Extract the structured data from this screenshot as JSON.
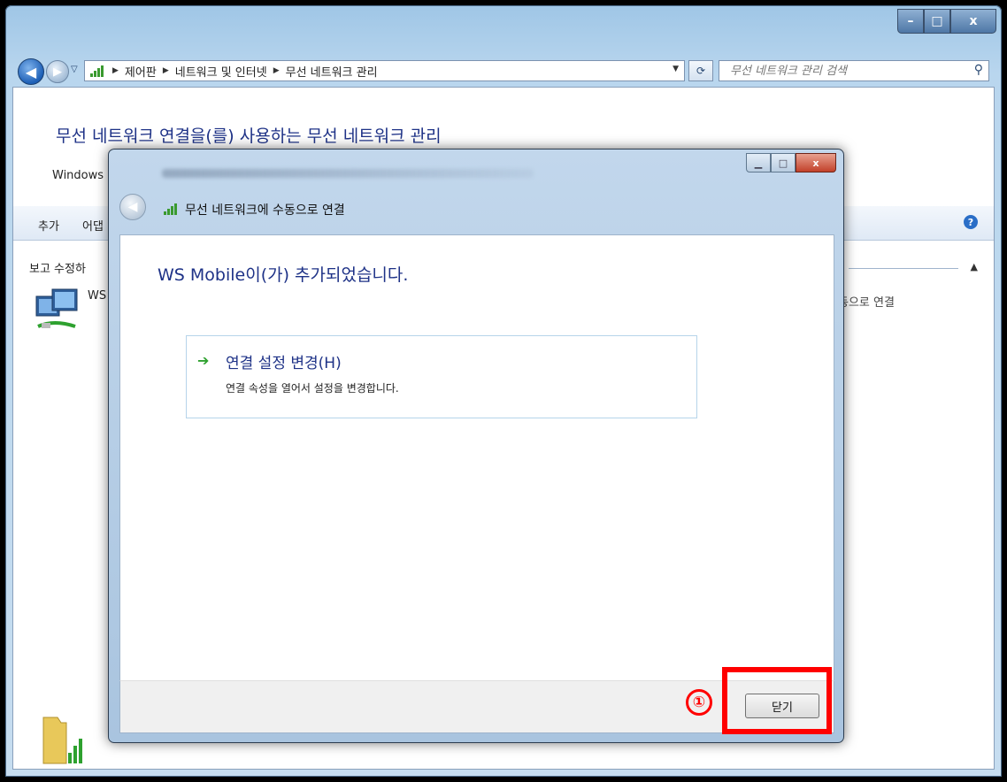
{
  "window": {
    "controls": {
      "minimize": "–",
      "maximize": "□",
      "close": "x"
    }
  },
  "navbar": {
    "breadcrumbs": [
      "제어판",
      "네트워크 및 인터넷",
      "무선 네트워크 관리"
    ],
    "search_placeholder": "무선 네트워크 관리 검색"
  },
  "page": {
    "title": "무선 네트워크 연결을(를) 사용하는 무선 네트워크 관리",
    "subtitle": "Windows",
    "commands": [
      "추가",
      "어댑"
    ],
    "list_header": "보고 수정하",
    "network_name": "WS",
    "network_status": "동으로 연결"
  },
  "dialog": {
    "title": "무선 네트워크에 수동으로 연결",
    "heading": "WS Mobile이(가) 추가되었습니다.",
    "option": {
      "title": "연결 설정 변경(H)",
      "description": "연결 속성을 열어서 설정을 변경합니다."
    },
    "close_button": "닫기"
  },
  "annotation": {
    "step": "①",
    "color": "#ff0000"
  },
  "colors": {
    "heading_blue": "#1e3287",
    "link_green": "#2ea12f"
  }
}
